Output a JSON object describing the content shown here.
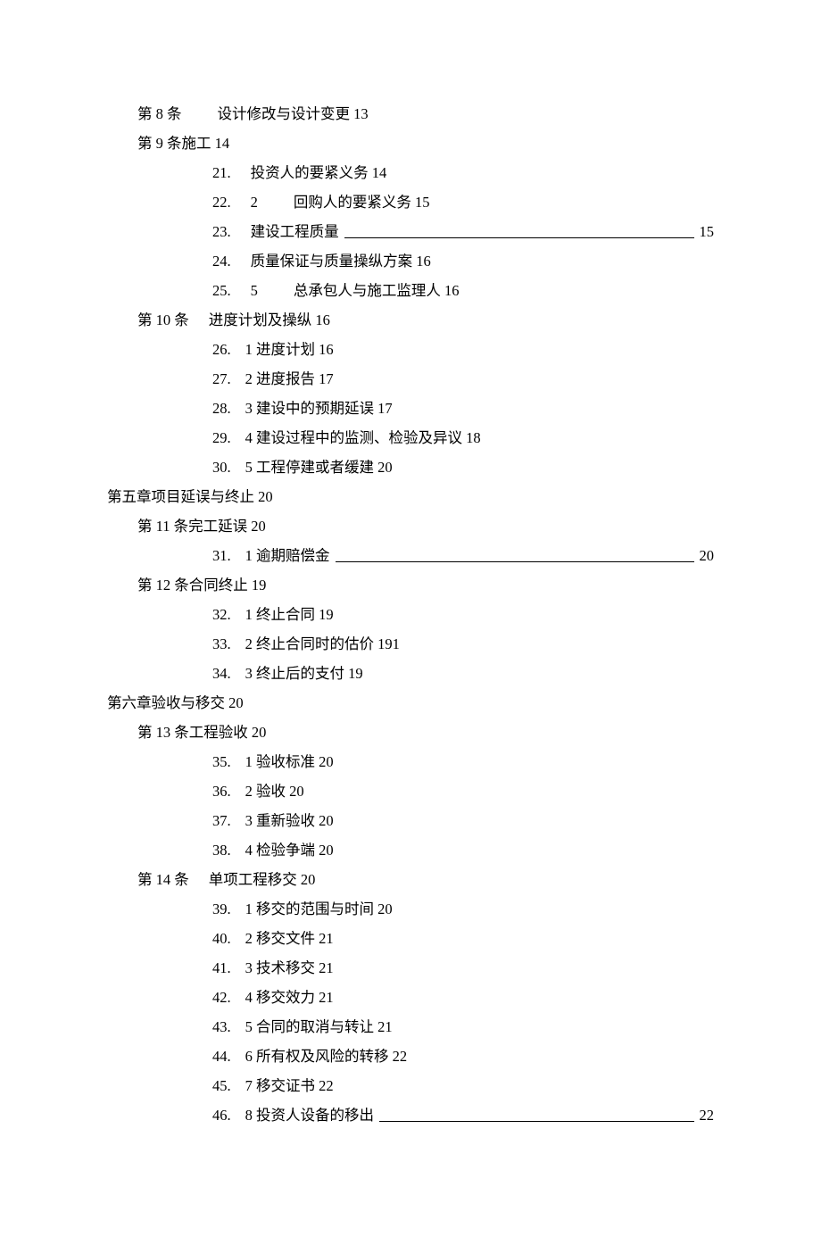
{
  "lines": [
    {
      "indent": 1,
      "segments": [
        "第 8 条",
        "gap-md",
        "设计修改与设计变更 13"
      ]
    },
    {
      "indent": 1,
      "segments": [
        "第 9 条施工 14"
      ]
    },
    {
      "indent": 2,
      "segments": [
        "21.",
        "gap-sm",
        "投资人的要紧义务 14"
      ]
    },
    {
      "indent": 2,
      "segments": [
        "22.",
        "gap-sm",
        "2",
        "gap-md",
        "回购人的要紧义务 15"
      ]
    },
    {
      "indent": 2,
      "segments": [
        "23.",
        "gap-sm",
        "建设工程质量",
        "rule",
        "15"
      ]
    },
    {
      "indent": 2,
      "segments": [
        "24.",
        "gap-sm",
        "质量保证与质量操纵方案 16"
      ]
    },
    {
      "indent": 2,
      "segments": [
        "25.",
        "gap-sm",
        "5",
        "gap-md",
        "总承包人与施工监理人 16"
      ]
    },
    {
      "indent": 1,
      "segments": [
        "第 10 条",
        "gap-sm",
        "进度计划及操纵 16"
      ]
    },
    {
      "indent": 2,
      "segments": [
        "26.",
        "numspace",
        "1 进度计划 16"
      ]
    },
    {
      "indent": 2,
      "segments": [
        "27.",
        "numspace",
        "2 进度报告 17"
      ]
    },
    {
      "indent": 2,
      "segments": [
        "28.",
        "numspace",
        "3 建设中的预期延误 17"
      ]
    },
    {
      "indent": 2,
      "segments": [
        "29.",
        "numspace",
        "4 建设过程中的监测、检验及异议 18"
      ]
    },
    {
      "indent": 2,
      "segments": [
        "30.",
        "numspace",
        "5 工程停建或者缓建 20"
      ]
    },
    {
      "indent": 0,
      "segments": [
        "第五章项目延误与终止 20"
      ]
    },
    {
      "indent": 1,
      "segments": [
        "第 11 条完工延误 20"
      ]
    },
    {
      "indent": 2,
      "segments": [
        "31.",
        "numspace",
        "1 逾期赔偿金",
        "rule",
        "20"
      ]
    },
    {
      "indent": 1,
      "segments": [
        "第 12 条合同终止 19"
      ]
    },
    {
      "indent": 2,
      "segments": [
        "32.",
        "numspace",
        "1 终止合同 19"
      ]
    },
    {
      "indent": 2,
      "segments": [
        "33.",
        "numspace",
        "2 终止合同时的估价 191"
      ]
    },
    {
      "indent": 2,
      "segments": [
        "34.",
        "numspace",
        "3 终止后的支付 19"
      ]
    },
    {
      "indent": 0,
      "segments": [
        "第六章验收与移交 20"
      ]
    },
    {
      "indent": 1,
      "segments": [
        "第 13 条工程验收 20"
      ]
    },
    {
      "indent": 2,
      "segments": [
        "35.",
        "numspace",
        "1 验收标准 20"
      ]
    },
    {
      "indent": 2,
      "segments": [
        "36.",
        "numspace",
        "2 验收 20"
      ]
    },
    {
      "indent": 2,
      "segments": [
        "37.",
        "numspace",
        "3 重新验收 20"
      ]
    },
    {
      "indent": 2,
      "segments": [
        "38.",
        "numspace",
        "4 检验争端 20"
      ]
    },
    {
      "indent": 1,
      "segments": [
        "第 14 条",
        "gap-sm",
        "单项工程移交 20"
      ]
    },
    {
      "indent": 2,
      "segments": [
        "39.",
        "numspace",
        "1 移交的范围与时间 20"
      ]
    },
    {
      "indent": 2,
      "segments": [
        "40.",
        "numspace",
        "2 移交文件 21"
      ]
    },
    {
      "indent": 2,
      "segments": [
        "41.",
        "numspace",
        "3 技术移交 21"
      ]
    },
    {
      "indent": 2,
      "segments": [
        "42.",
        "numspace",
        "4 移交效力 21"
      ]
    },
    {
      "indent": 2,
      "segments": [
        "43.",
        "numspace",
        "5 合同的取消与转让 21"
      ]
    },
    {
      "indent": 2,
      "segments": [
        "44.",
        "numspace",
        "6 所有权及风险的转移 22"
      ]
    },
    {
      "indent": 2,
      "segments": [
        "45.",
        "numspace",
        "7 移交证书 22"
      ]
    },
    {
      "indent": 2,
      "segments": [
        "46.",
        "numspace",
        "8 投资人设备的移出",
        "rule",
        "22"
      ]
    }
  ]
}
